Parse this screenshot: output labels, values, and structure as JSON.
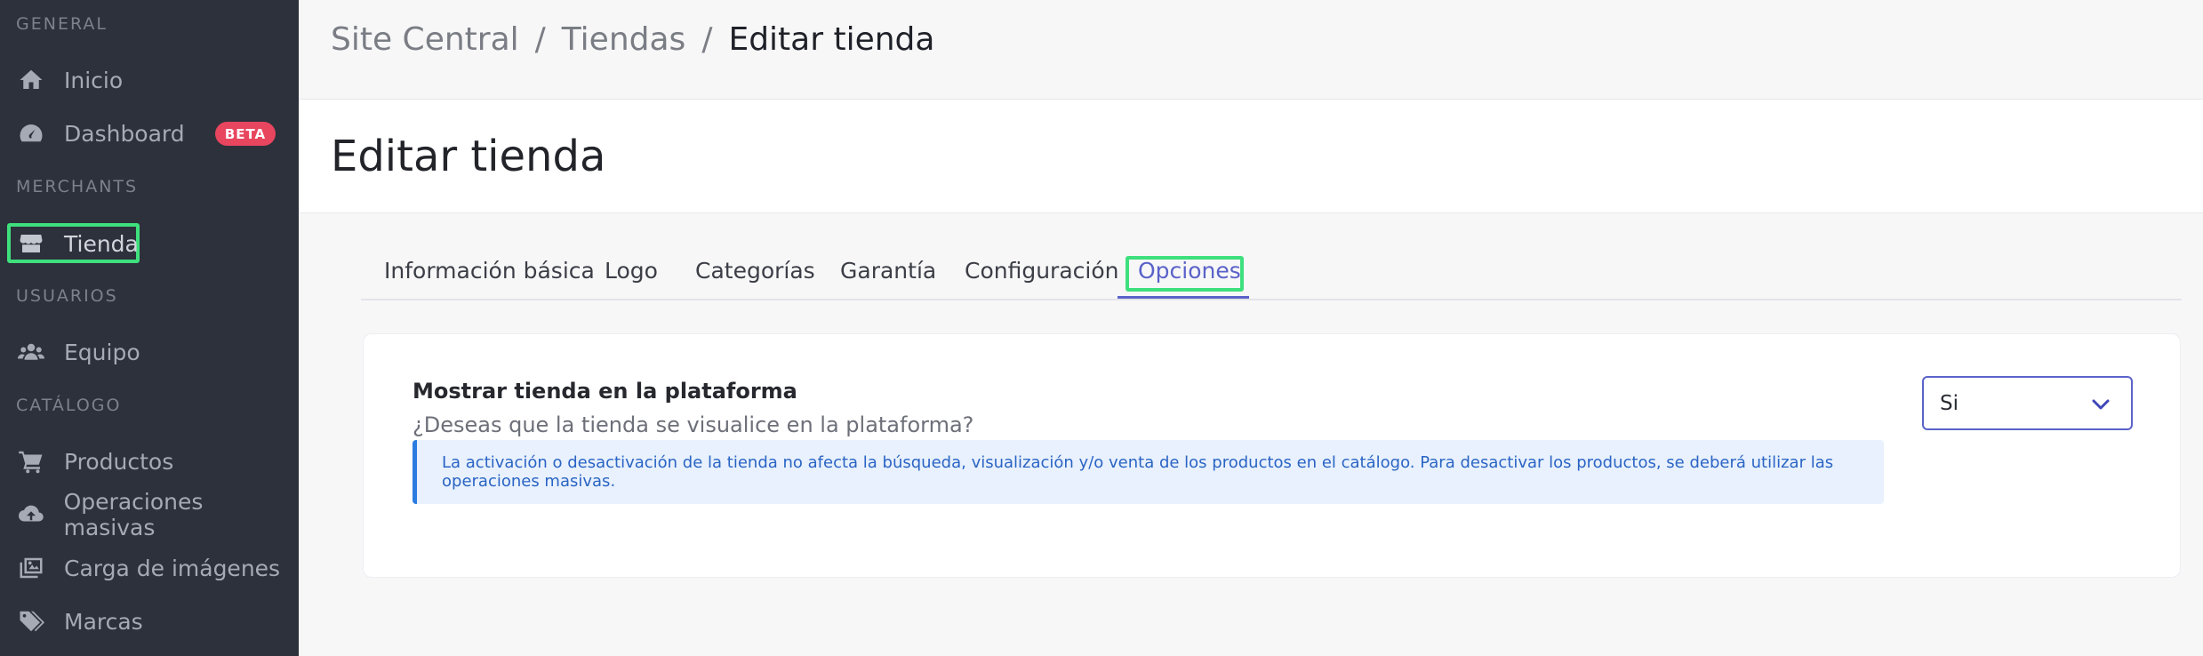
{
  "sidebar": {
    "sections": {
      "general": "GENERAL",
      "merchants": "MERCHANTS",
      "usuarios": "USUARIOS",
      "catalogo": "CATÁLOGO"
    },
    "items": {
      "inicio": {
        "label": "Inicio",
        "icon": "home-icon"
      },
      "dashboard": {
        "label": "Dashboard",
        "icon": "gauge-icon",
        "badge": "BETA"
      },
      "tienda": {
        "label": "Tienda",
        "icon": "store-icon"
      },
      "equipo": {
        "label": "Equipo",
        "icon": "users-icon"
      },
      "productos": {
        "label": "Productos",
        "icon": "cart-icon"
      },
      "operaciones": {
        "label": "Operaciones masivas",
        "icon": "cloud-upload-icon"
      },
      "carga": {
        "label": "Carga de imágenes",
        "icon": "images-icon"
      },
      "marcas": {
        "label": "Marcas",
        "icon": "tags-icon"
      }
    },
    "active_item": "Tienda"
  },
  "header": {
    "breadcrumb": [
      "Site Central",
      "Tiendas",
      "Editar tienda"
    ],
    "separator": "/"
  },
  "page": {
    "title": "Editar tienda"
  },
  "tabs": [
    "Información básica",
    "Logo",
    "Categorías",
    "Garantía",
    "Configuración",
    "Opciones"
  ],
  "active_tab": "Opciones",
  "option": {
    "title": "Mostrar tienda en la plataforma",
    "description": "¿Deseas que la tienda se visualice en la plataforma?",
    "alert": "La activación o desactivación de la tienda no afecta la búsqueda, visualización y/o venta de los productos en el catálogo. Para desactivar los productos, se deberá utilizar las operaciones masivas.",
    "select_value": "Si"
  },
  "colors": {
    "sidebar_bg": "#2d313b",
    "accent": "#5b63c9",
    "highlight": "#3ee07d",
    "badge": "#e8455f",
    "alert_bg": "#e8f1fd",
    "alert_text": "#2a64c4"
  }
}
